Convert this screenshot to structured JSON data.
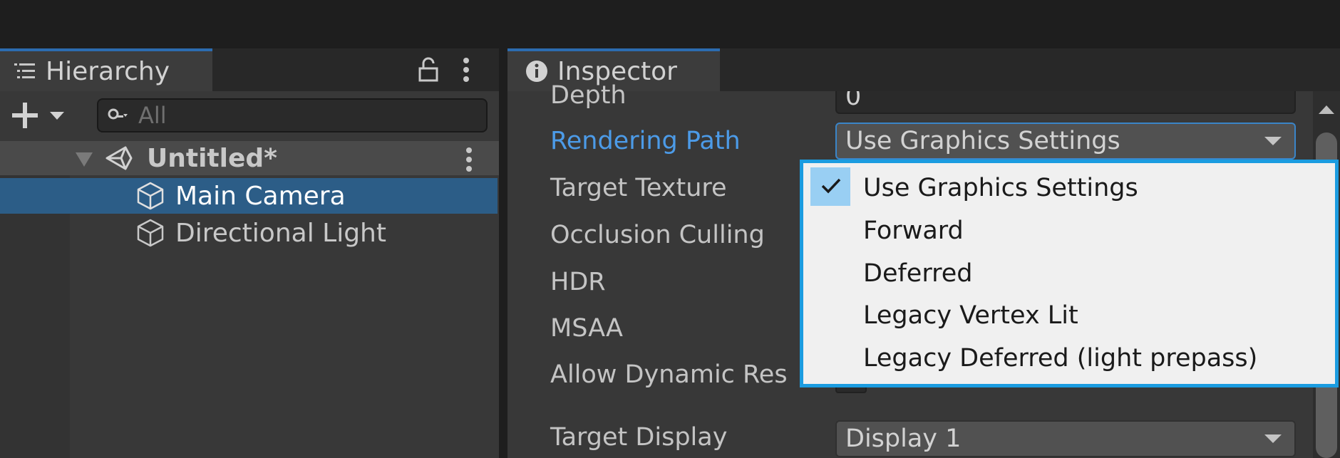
{
  "hierarchy": {
    "tab_label": "Hierarchy",
    "search_placeholder": "All",
    "scene": {
      "name": "Untitled*"
    },
    "items": [
      {
        "label": "Main Camera",
        "selected": true
      },
      {
        "label": "Directional Light",
        "selected": false
      }
    ]
  },
  "inspector": {
    "tab_label": "Inspector",
    "rows": {
      "depth": {
        "label": "Depth",
        "value": "0"
      },
      "rendering_path": {
        "label": "Rendering Path",
        "value": "Use Graphics Settings"
      },
      "target_texture": {
        "label": "Target Texture"
      },
      "occlusion_culling": {
        "label": "Occlusion Culling"
      },
      "hdr": {
        "label": "HDR"
      },
      "msaa": {
        "label": "MSAA"
      },
      "allow_dynamic_res": {
        "label": "Allow Dynamic Res"
      },
      "target_display": {
        "label": "Target Display",
        "value": "Display 1"
      }
    }
  },
  "dropdown": {
    "options": [
      "Use Graphics Settings",
      "Forward",
      "Deferred",
      "Legacy Vertex Lit",
      "Legacy Deferred (light prepass)"
    ],
    "selected_index": 0
  },
  "colors": {
    "highlight_label": "#4c9be8",
    "selection_row": "#2c5d87",
    "popup_border": "#1b9ce0",
    "check_bg": "#99cff3",
    "tab_accent": "#2c6cb0"
  },
  "icons": {
    "hierarchy_tab": "list-icon",
    "inspector_tab": "info-icon",
    "lock": "lock-icon",
    "menu": "kebab-menu-icon",
    "create": "plus-icon",
    "search": "search-icon",
    "scene": "unity-logo-icon",
    "gameobject": "cube-icon",
    "check": "checkmark-icon"
  }
}
